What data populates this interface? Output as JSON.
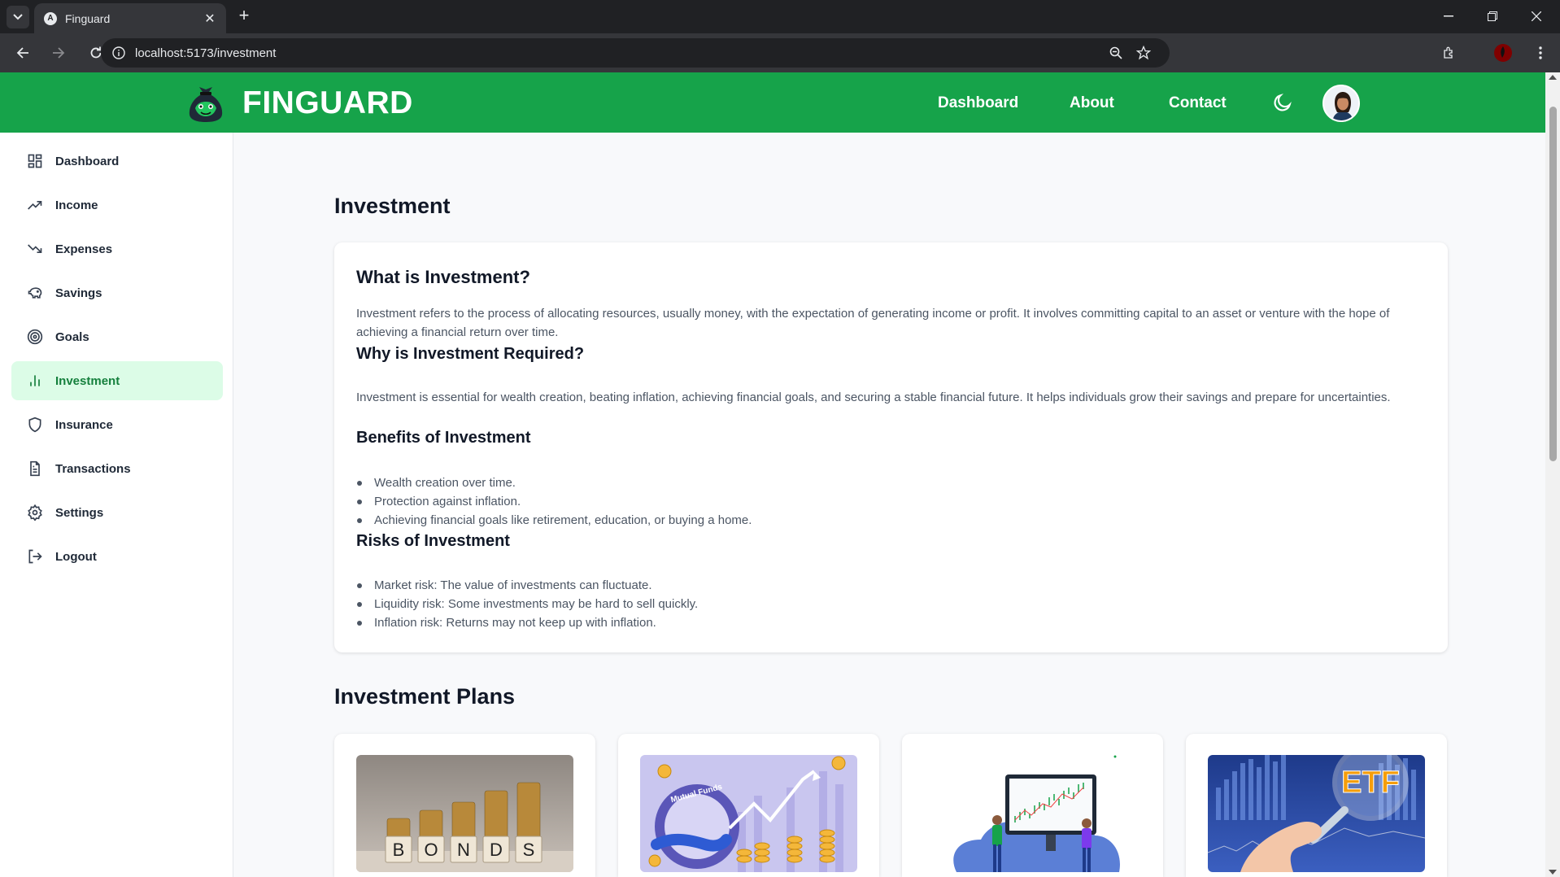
{
  "browser": {
    "tab_title": "Finguard",
    "url": "localhost:5173/investment"
  },
  "header": {
    "logo": "FINGUARD",
    "nav": [
      "Dashboard",
      "About",
      "Contact"
    ],
    "brand_color": "#16a34a"
  },
  "sidebar": {
    "items": [
      {
        "label": "Dashboard",
        "icon": "grid-icon"
      },
      {
        "label": "Income",
        "icon": "trending-up-icon"
      },
      {
        "label": "Expenses",
        "icon": "trending-down-icon"
      },
      {
        "label": "Savings",
        "icon": "piggy-bank-icon"
      },
      {
        "label": "Goals",
        "icon": "target-icon"
      },
      {
        "label": "Investment",
        "icon": "bar-chart-icon",
        "active": true
      },
      {
        "label": "Insurance",
        "icon": "shield-icon"
      },
      {
        "label": "Transactions",
        "icon": "file-text-icon"
      },
      {
        "label": "Settings",
        "icon": "gear-icon"
      },
      {
        "label": "Logout",
        "icon": "logout-icon"
      }
    ]
  },
  "main": {
    "title": "Investment",
    "what_heading": "What is Investment?",
    "what_text": "Investment refers to the process of allocating resources, usually money, with the expectation of generating income or profit. It involves committing capital to an asset or venture with the hope of achieving a financial return over time.",
    "why_heading": "Why is Investment Required?",
    "why_text": "Investment is essential for wealth creation, beating inflation, achieving financial goals, and securing a stable financial future. It helps individuals grow their savings and prepare for uncertainties.",
    "benefits_heading": "Benefits of Investment",
    "benefits": [
      "Wealth creation over time.",
      "Protection against inflation.",
      "Achieving financial goals like retirement, education, or buying a home."
    ],
    "risks_heading": "Risks of Investment",
    "risks": [
      "Market risk: The value of investments can fluctuate.",
      "Liquidity risk: Some investments may be hard to sell quickly.",
      "Inflation risk: Returns may not keep up with inflation."
    ],
    "plans_title": "Investment Plans",
    "plans": [
      {
        "image_text": "BONDS"
      },
      {
        "image_text": "Mutual Funds"
      },
      {
        "image_text": ""
      },
      {
        "image_text": "ETF"
      }
    ]
  }
}
